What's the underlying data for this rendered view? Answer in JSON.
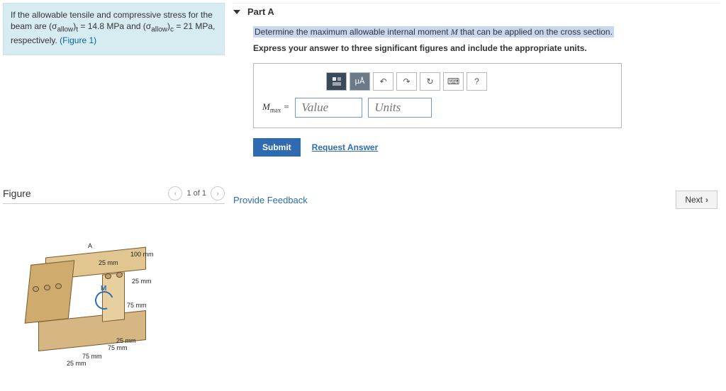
{
  "problem": {
    "intro": "If the allowable tensile and compressive stress for the beam are ",
    "sigmaT_sym": "(σallow)t",
    "sigmaT_val": " = 14.8 MPa",
    "and": " and ",
    "sigmaC_sym": "(σallow)c",
    "sigmaC_val": " = 21 MPa, respectively. ",
    "figlink": "(Figure 1)"
  },
  "figure": {
    "title": "Figure",
    "pager": "1 of 1",
    "dims": {
      "d100": "100 mm",
      "d25a": "25 mm",
      "d25b": "25 mm",
      "d75a": "75 mm",
      "d25c": "25 mm",
      "d75b": "75 mm",
      "d75c": "75 mm",
      "d25d": "25 mm",
      "A": "A",
      "M": "M"
    }
  },
  "partA": {
    "label": "Part A",
    "question_pre": "Determine the maximum allowable internal moment ",
    "question_var": "M",
    "question_post": " that can be applied on the cross section.",
    "instruction": "Express your answer to three significant figures and include the appropriate units.",
    "mmax_label": "Mmax =",
    "value_placeholder": "Value",
    "units_placeholder": "Units",
    "toolbar": {
      "mu": "μÅ",
      "undo": "↶",
      "redo": "↷",
      "reset": "↻",
      "kb": "⌨",
      "help": "?"
    },
    "submit": "Submit",
    "request": "Request Answer"
  },
  "footer": {
    "feedback": "Provide Feedback",
    "next": "Next"
  }
}
